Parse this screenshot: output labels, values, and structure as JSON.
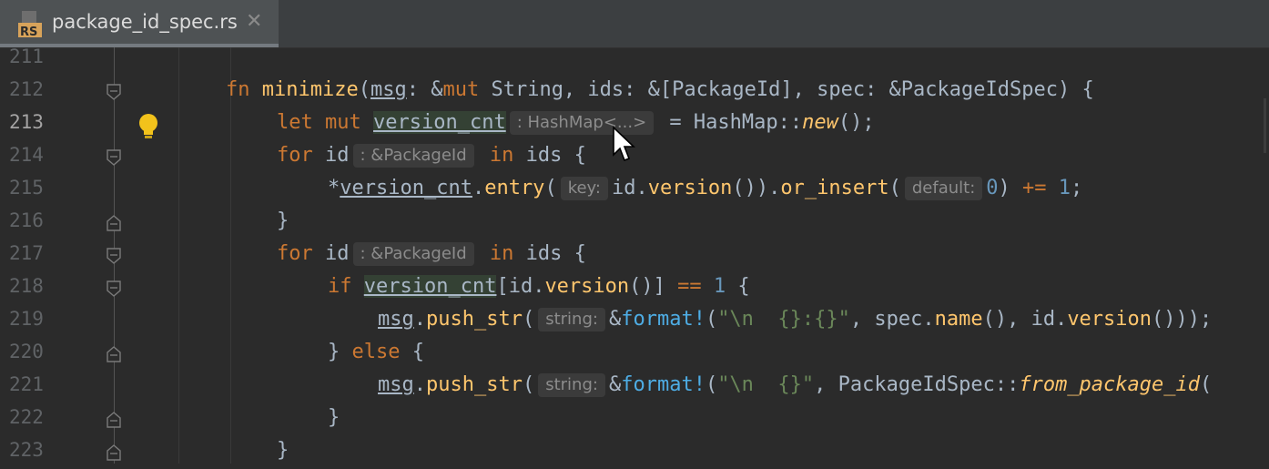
{
  "tab": {
    "file_name": "package_id_spec.rs",
    "file_type": "RS",
    "close_glyph": "✕"
  },
  "lines": [
    {
      "num": "211"
    },
    {
      "num": "212"
    },
    {
      "num": "213"
    },
    {
      "num": "214"
    },
    {
      "num": "215"
    },
    {
      "num": "216"
    },
    {
      "num": "217"
    },
    {
      "num": "218"
    },
    {
      "num": "219"
    },
    {
      "num": "220"
    },
    {
      "num": "221"
    },
    {
      "num": "222"
    },
    {
      "num": "223"
    }
  ],
  "hints": {
    "hashmap_type": ": HashMap<...>",
    "package_id_type": ": &PackageId",
    "key": "key:",
    "default": "default:",
    "string": "string:"
  },
  "colors": {
    "background": "#2b2b2b",
    "keyword": "#cc7832",
    "function": "#ffc66d",
    "number": "#6897bb",
    "string": "#6a8759",
    "macro": "#4eade5",
    "text": "#a9b7c6"
  }
}
